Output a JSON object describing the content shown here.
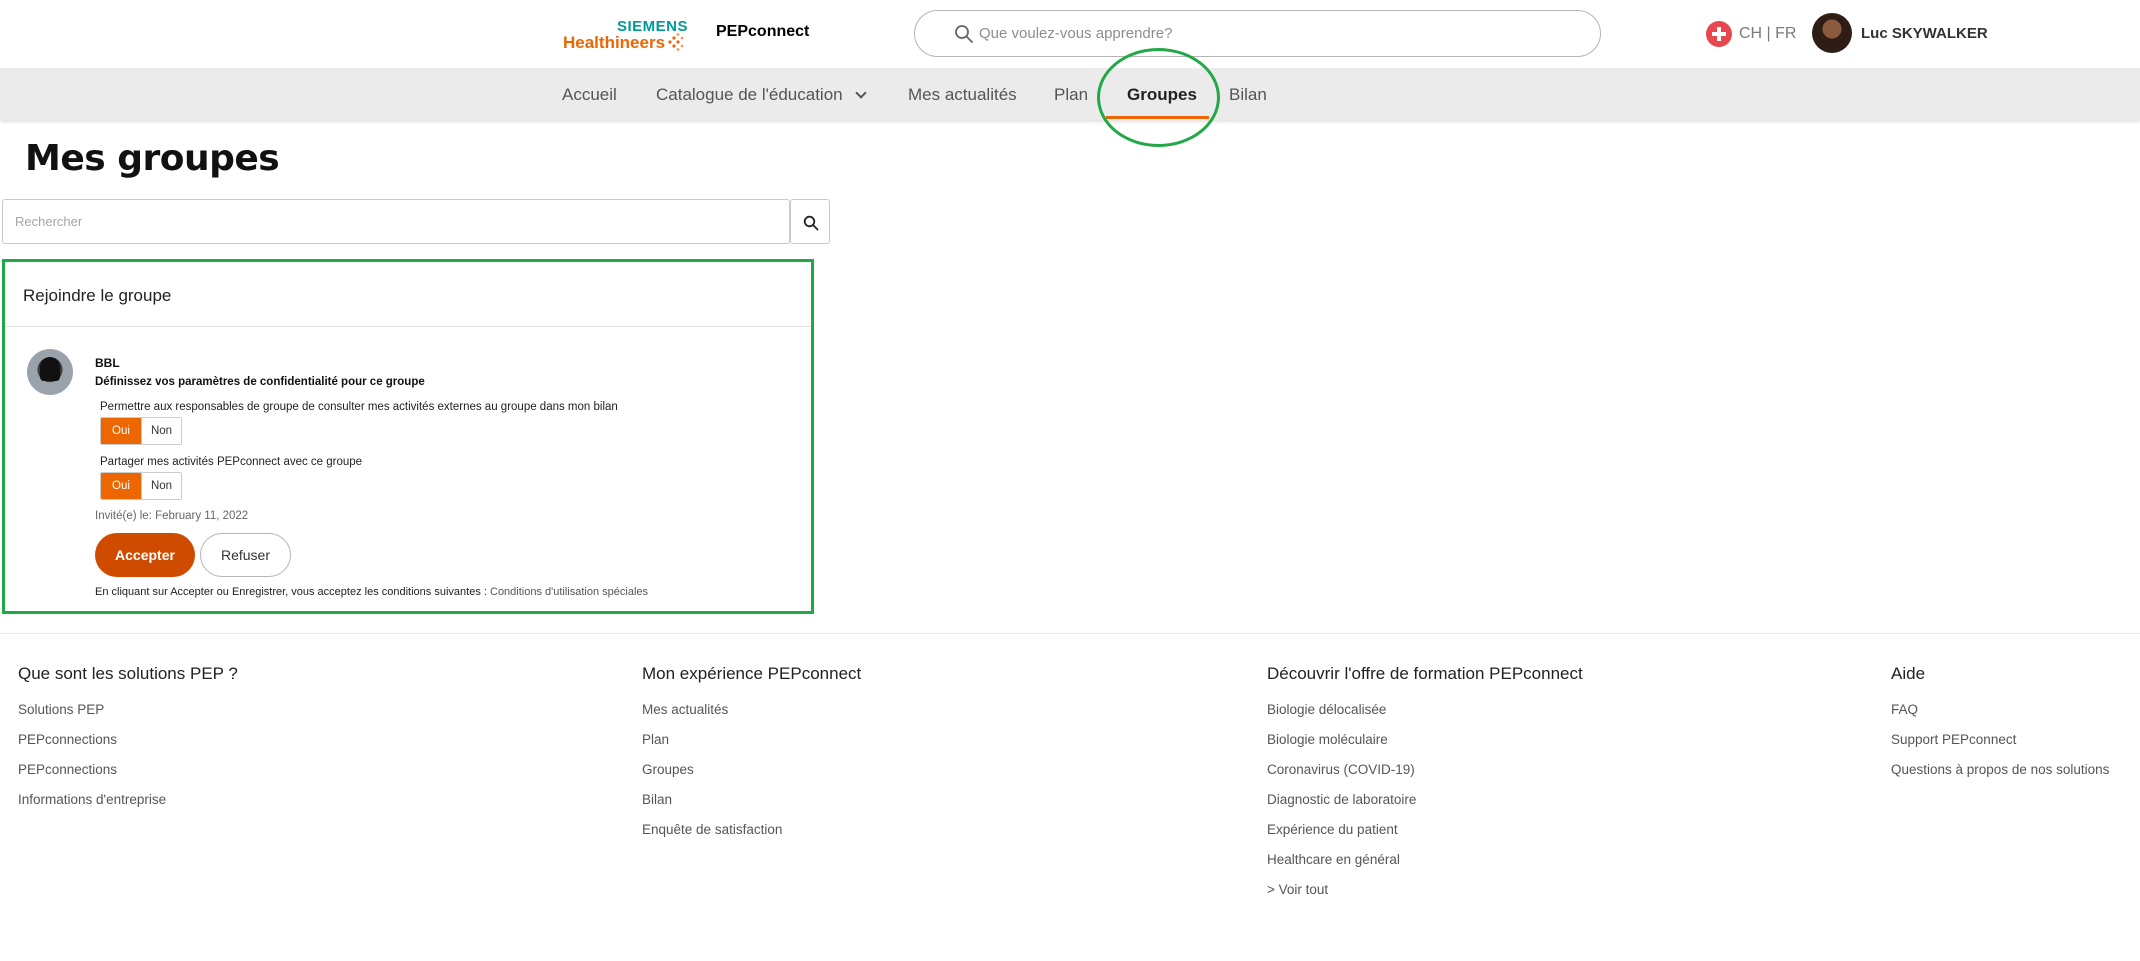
{
  "header": {
    "logo_line1": "SIEMENS",
    "logo_line2": "Healthineers",
    "brand": "PEPconnect",
    "search_placeholder": "Que voulez-vous apprendre?",
    "locale": "CH | FR",
    "user_name": "Luc SKYWALKER"
  },
  "nav": {
    "items": [
      "Accueil",
      "Catalogue de l'éducation",
      "Mes actualités",
      "Plan",
      "Groupes",
      "Bilan"
    ],
    "active": "Groupes"
  },
  "page": {
    "title": "Mes groupes",
    "search_placeholder": "Rechercher"
  },
  "join_card": {
    "title": "Rejoindre le groupe",
    "group_name": "BBL",
    "privacy_heading": "Définissez vos paramètres de confidentialité pour ce groupe",
    "options": [
      {
        "label": "Permettre aux responsables de groupe de consulter mes activités externes au groupe dans mon bilan",
        "yes": "Oui",
        "no": "Non",
        "selected": "Oui"
      },
      {
        "label": "Partager mes activités PEPconnect avec ce groupe",
        "yes": "Oui",
        "no": "Non",
        "selected": "Oui"
      }
    ],
    "invited": "Invité(e) le: February 11, 2022",
    "accept_label": "Accepter",
    "refuse_label": "Refuser",
    "terms_text": "En cliquant sur Accepter ou Enregistrer, vous acceptez les conditions suivantes :",
    "terms_link": "Conditions d'utilisation spéciales"
  },
  "footer": {
    "columns": [
      {
        "title": "Que sont les solutions PEP ?",
        "links": [
          "Solutions PEP",
          "PEPconnections",
          "PEPconnections",
          "Informations d'entreprise"
        ]
      },
      {
        "title": "Mon expérience PEPconnect",
        "links": [
          "Mes actualités",
          "Plan",
          "Groupes",
          "Bilan",
          "Enquête de satisfaction"
        ]
      },
      {
        "title": "Découvrir l'offre de formation PEPconnect",
        "links": [
          "Biologie délocalisée",
          "Biologie moléculaire",
          "Coronavirus (COVID-19)",
          "Diagnostic de laboratoire",
          "Expérience du patient",
          "Healthcare en général",
          "> Voir tout"
        ]
      },
      {
        "title": "Aide",
        "links": [
          "FAQ",
          "Support PEPconnect",
          "Questions à propos de nos solutions"
        ]
      }
    ]
  },
  "colors": {
    "accent": "#ec6602",
    "accept_button": "#cf4b00",
    "highlight": "#22a847",
    "brand_teal": "#009999"
  }
}
